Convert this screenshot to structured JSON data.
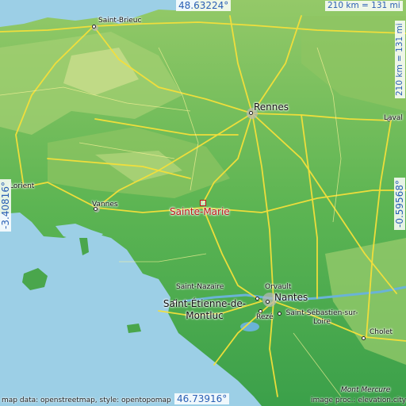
{
  "map": {
    "target": {
      "name": "Sainte-Marie"
    },
    "coordinates": {
      "top": "48.63224°",
      "bottom": "46.73916°",
      "left": "-3.40816°",
      "right": "-0.59568°"
    },
    "scale": {
      "horizontal": "210 km = 131 mi",
      "vertical": "210 km = 131 mi"
    },
    "places": [
      {
        "id": "saint-brieuc",
        "name": "Saint-Brieuc"
      },
      {
        "id": "rennes",
        "name": "Rennes"
      },
      {
        "id": "laval",
        "name": "Laval"
      },
      {
        "id": "lorient",
        "name": "Lorient"
      },
      {
        "id": "vannes",
        "name": "Vannes"
      },
      {
        "id": "saint-nazaire",
        "name": "Saint-Nazaire"
      },
      {
        "id": "saint-etienne",
        "name": "Saint-Étienne-de-Montluc"
      },
      {
        "id": "orvault",
        "name": "Orvault"
      },
      {
        "id": "nantes",
        "name": "Nantes"
      },
      {
        "id": "reze",
        "name": "Rezé"
      },
      {
        "id": "saint-sebastien",
        "name": "Saint-Sébastien-sur-Loire"
      },
      {
        "id": "cholet",
        "name": "Cholet"
      },
      {
        "id": "mont-mercure",
        "name": "Mont Mercure"
      }
    ],
    "credits": {
      "left": "map data: openstreetmap, style: opentopomap",
      "right": "image proc.: elevation.city"
    },
    "colors": {
      "sea": "#9ccfe6",
      "lowland": "#3aa04a",
      "midland": "#7cc25a",
      "upland": "#b7d879",
      "roads": "#f5e03a",
      "target": "#c01818",
      "coordinate_text": "#2a5fb5"
    }
  }
}
